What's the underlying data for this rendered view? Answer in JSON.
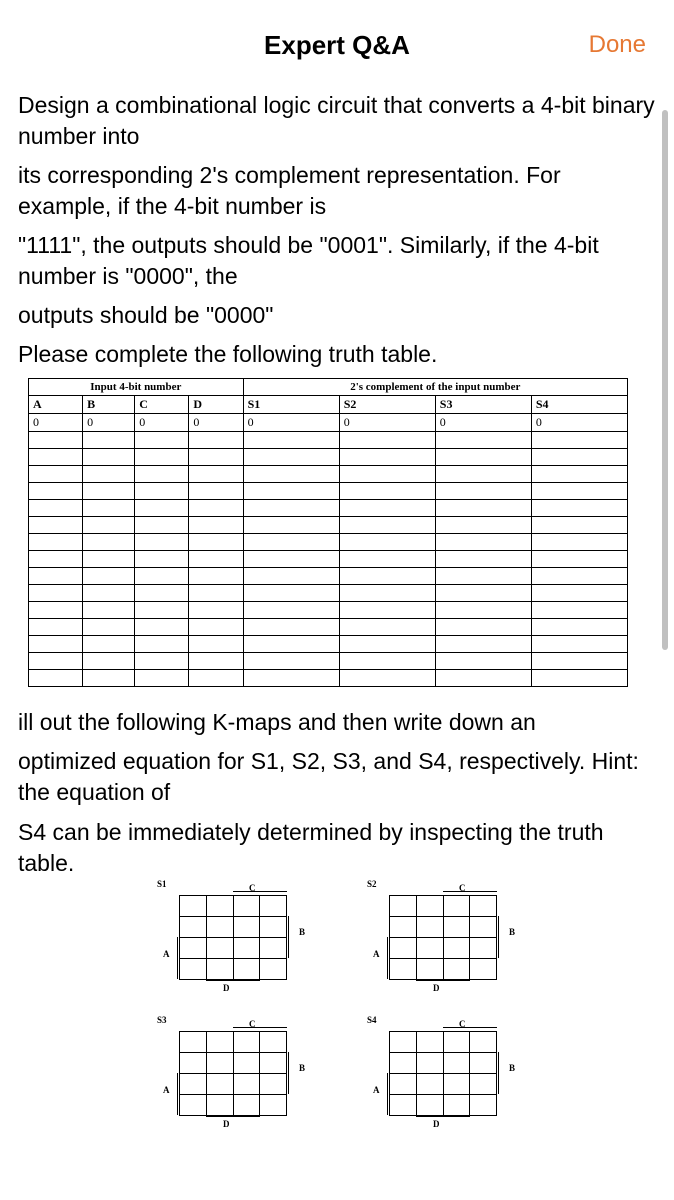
{
  "header": {
    "title": "Expert Q&A",
    "done": "Done"
  },
  "question": {
    "para1": "Design a combinational logic circuit that converts a 4-bit binary number into",
    "para2": "its corresponding 2's complement representation. For example, if the 4-bit number is",
    "para3": "\"1111\", the outputs should be \"0001\". Similarly, if the 4-bit number is \"0000\", the",
    "para4": "outputs should be \"0000\"",
    "para5": "Please complete the following truth table.",
    "para6": "ill out the following K-maps and then write down an",
    "para7": "optimized equation for S1, S2, S3, and S4, respectively. Hint: the equation of",
    "para8": "S4 can be immediately determined by inspecting the truth table."
  },
  "truth_table": {
    "group_headers": [
      "Input 4-bit number",
      "2's complement of the input number"
    ],
    "col_headers": [
      "A",
      "B",
      "C",
      "D",
      "S1",
      "S2",
      "S3",
      "S4"
    ],
    "row0": [
      "0",
      "0",
      "0",
      "0",
      "0",
      "0",
      "0",
      "0"
    ]
  },
  "kmaps": {
    "s1": {
      "name": "S1",
      "axes": {
        "A": "A",
        "B": "B",
        "C": "C",
        "D": "D"
      }
    },
    "s2": {
      "name": "S2",
      "axes": {
        "A": "A",
        "B": "B",
        "C": "C",
        "D": "D"
      }
    },
    "s3": {
      "name": "S3",
      "axes": {
        "A": "A",
        "B": "B",
        "C": "C",
        "D": "D"
      }
    },
    "s4": {
      "name": "S4",
      "axes": {
        "A": "A",
        "B": "B",
        "C": "C",
        "D": "D"
      }
    }
  }
}
